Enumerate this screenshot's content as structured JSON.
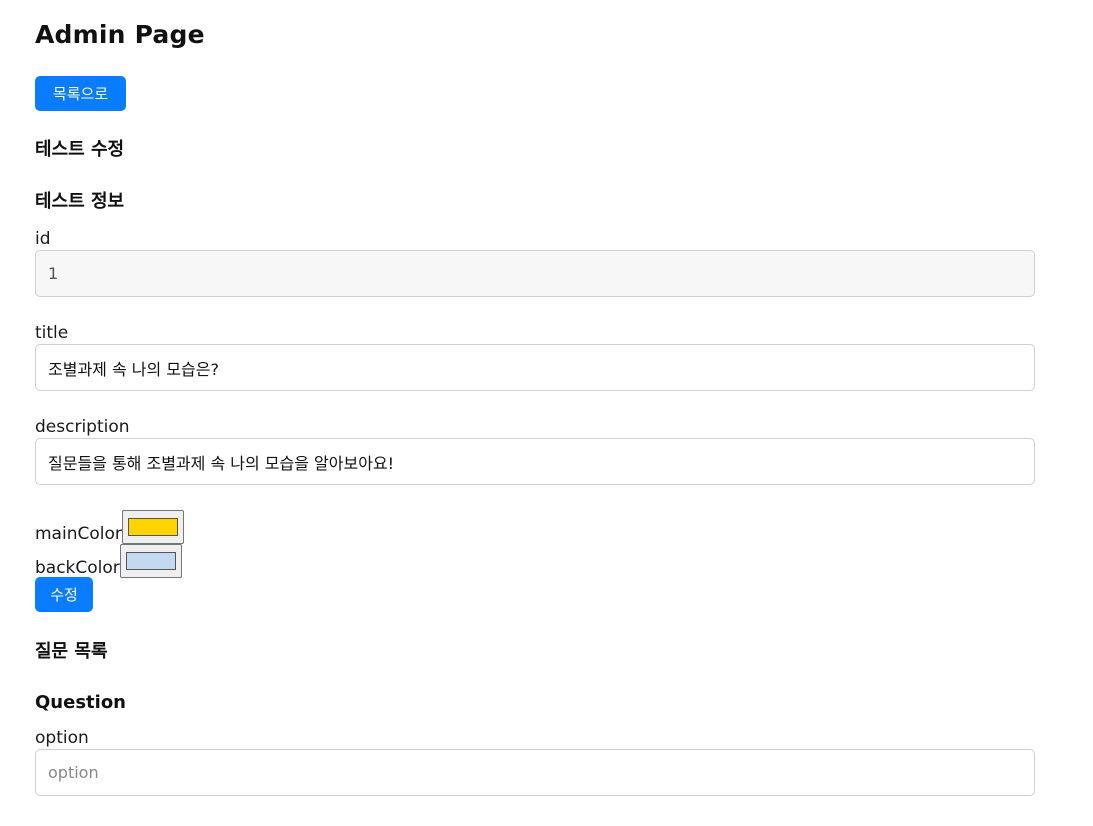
{
  "header": {
    "title": "Admin Page"
  },
  "nav": {
    "back_label": "목록으로"
  },
  "edit_section": {
    "heading": "테스트 수정"
  },
  "info_section": {
    "heading": "테스트 정보",
    "id": {
      "label": "id",
      "value": "1"
    },
    "title": {
      "label": "title",
      "value": "조별과제 속 나의 모습은?"
    },
    "description": {
      "label": "description",
      "value": "질문들을 통해 조별과제 속 나의 모습을 알아보아요!"
    },
    "main_color": {
      "label": "mainColor",
      "value": "#ffd400"
    },
    "back_color": {
      "label": "backColor",
      "value": "#c3d9f1"
    },
    "update_label": "수정"
  },
  "questions_section": {
    "heading": "질문 목록",
    "question": {
      "heading": "Question",
      "option": {
        "label": "option",
        "placeholder": "option",
        "value": ""
      }
    }
  },
  "colors": {
    "accent": "#0a7cff"
  }
}
